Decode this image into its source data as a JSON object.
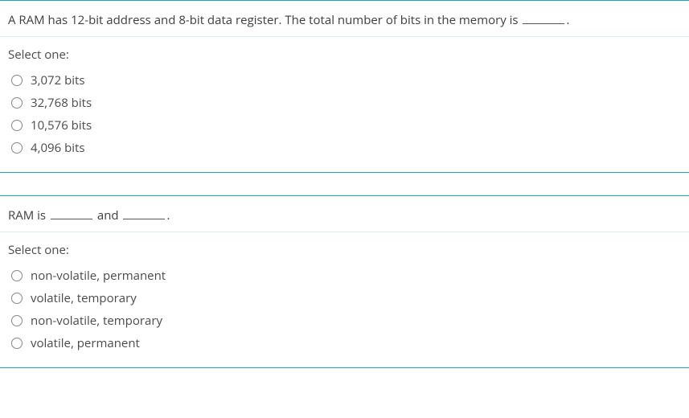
{
  "questions": [
    {
      "text_before": "A RAM has 12-bit address and 8-bit data register. The total number of bits in the memory is ",
      "text_after": ".",
      "select_label": "Select one:",
      "options": [
        "3,072 bits",
        "32,768 bits",
        "10,576 bits",
        "4,096 bits"
      ]
    },
    {
      "text_segments": [
        "RAM is ",
        " and ",
        "."
      ],
      "select_label": "Select one:",
      "options": [
        "non-volatile, permanent",
        "volatile, temporary",
        "non-volatile, temporary",
        "volatile, permanent"
      ]
    }
  ]
}
